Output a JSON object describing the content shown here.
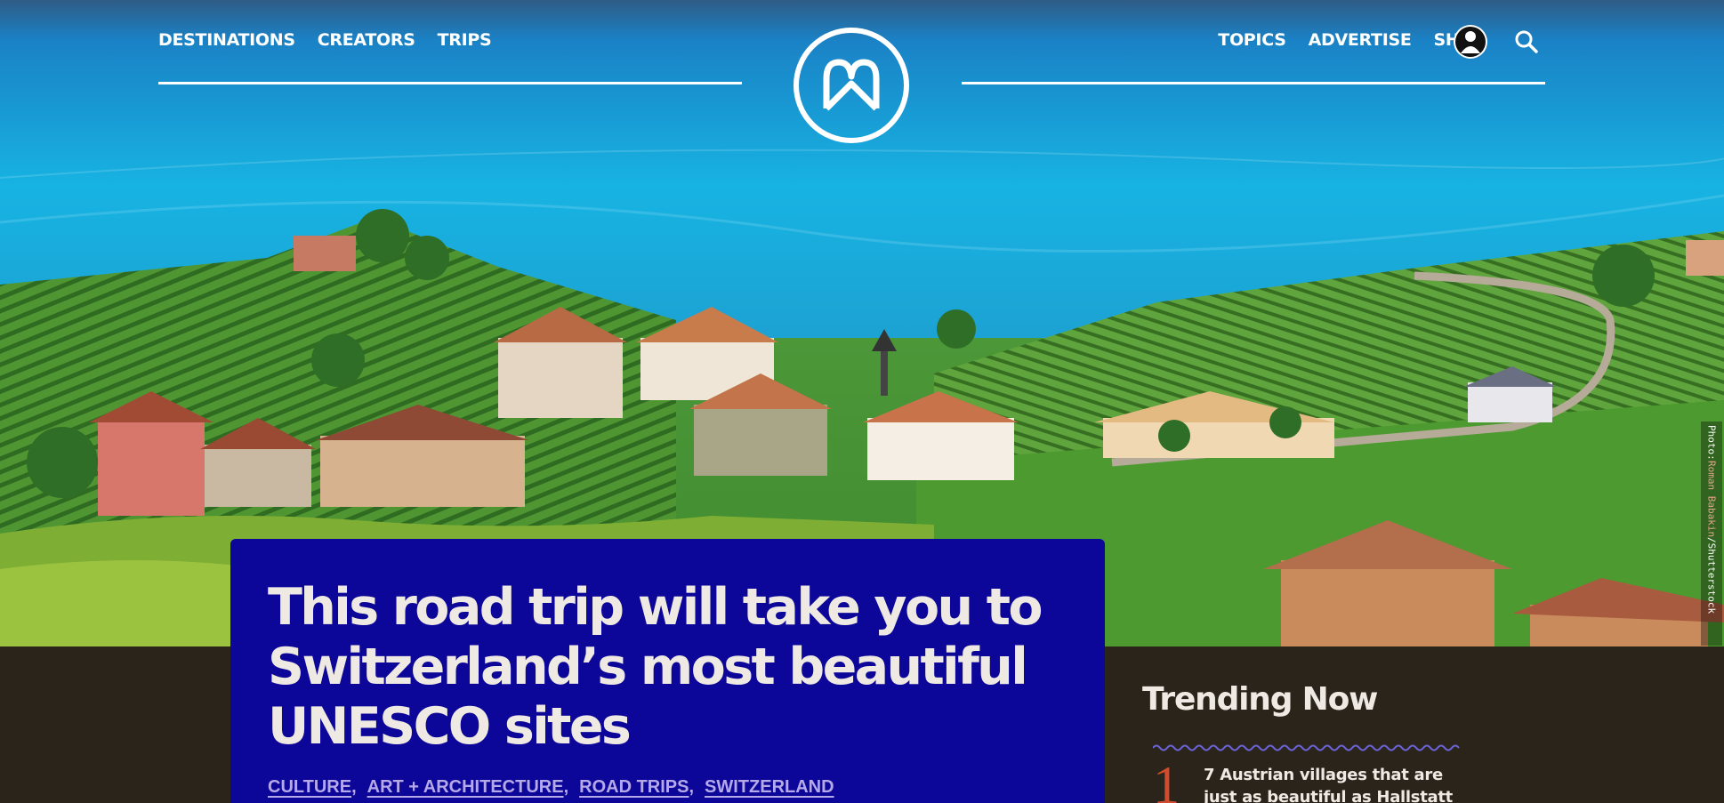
{
  "nav": {
    "left": [
      "DESTINATIONS",
      "CREATORS",
      "TRIPS"
    ],
    "right": [
      "TOPICS",
      "ADVERTISE",
      "SHOP"
    ]
  },
  "hero": {
    "credit_prefix": "Photo: ",
    "credit_author": "Roman Babakin",
    "credit_suffix": "/Shutterstock"
  },
  "article": {
    "headline": "This road trip will take you to Switzerland’s most beautiful UNESCO sites",
    "tags": [
      "CULTURE",
      "ART + ARCHITECTURE",
      "ROAD TRIPS",
      "SWITZERLAND"
    ]
  },
  "trending": {
    "title": "Trending Now",
    "items": [
      {
        "rank": "1",
        "title": "7 Austrian villages that are just as beautiful as Hallstatt"
      }
    ]
  },
  "colors": {
    "card": "#0d0799",
    "page_bg": "#2b241b",
    "accent": "#d24b2c",
    "tag": "#b5a9e8"
  },
  "icons": [
    "logo-icon",
    "avatar-icon",
    "search-icon"
  ]
}
